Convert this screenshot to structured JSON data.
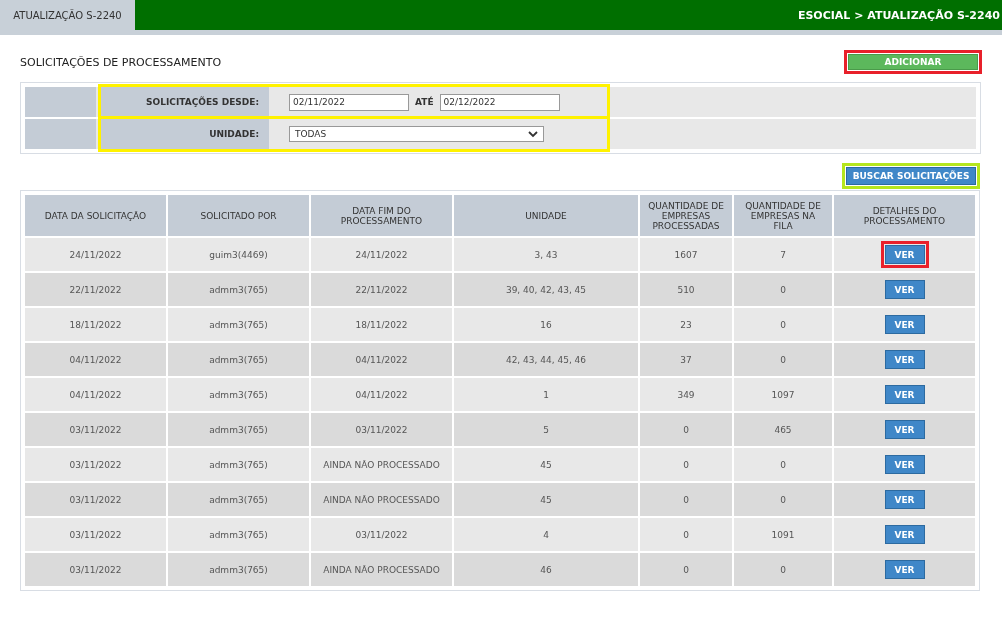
{
  "header": {
    "tab": {
      "label": "ATUALIZAÇÃO S-2240",
      "selected": true
    },
    "breadcrumb": "ESOCIAL > ATUALIZAÇÃO S-2240"
  },
  "page_title": "SOLICITAÇÕES DE PROCESSAMENTO",
  "add_button": {
    "label": "ADICIONAR",
    "highlighted": true
  },
  "filters": [
    {
      "label": "SOLICITAÇÕES DESDE:",
      "kind": "daterange",
      "from": "02/11/2022",
      "between": "ATÉ",
      "to": "02/12/2022",
      "highlighted": true
    },
    {
      "label": "UNIDADE:",
      "kind": "select",
      "value": "TODAS",
      "highlighted": true
    }
  ],
  "search_button": {
    "label": "BUSCAR SOLICITAÇÕES",
    "highlighted": true
  },
  "table": {
    "columns": [
      "DATA DA SOLICITAÇÃO",
      "SOLICITADO POR",
      "DATA FIM DO PROCESSAMENTO",
      "UNIDADE",
      "QUANTIDADE DE EMPRESAS PROCESSADAS",
      "QUANTIDADE DE EMPRESAS NA FILA",
      "DETALHES DO PROCESSAMENTO"
    ],
    "rows": [
      {
        "cells": [
          "24/11/2022",
          "guim3(4469)",
          "24/11/2022",
          "3, 43",
          "1607",
          "7"
        ],
        "action": "VER",
        "highlighted": true
      },
      {
        "cells": [
          "22/11/2022",
          "admm3(765)",
          "22/11/2022",
          "39, 40, 42, 43, 45",
          "510",
          "0"
        ],
        "action": "VER",
        "highlighted": false
      },
      {
        "cells": [
          "18/11/2022",
          "admm3(765)",
          "18/11/2022",
          "16",
          "23",
          "0"
        ],
        "action": "VER",
        "highlighted": false
      },
      {
        "cells": [
          "04/11/2022",
          "admm3(765)",
          "04/11/2022",
          "42, 43, 44, 45, 46",
          "37",
          "0"
        ],
        "action": "VER",
        "highlighted": false
      },
      {
        "cells": [
          "04/11/2022",
          "admm3(765)",
          "04/11/2022",
          "1",
          "349",
          "1097"
        ],
        "action": "VER",
        "highlighted": false
      },
      {
        "cells": [
          "03/11/2022",
          "admm3(765)",
          "03/11/2022",
          "5",
          "0",
          "465"
        ],
        "action": "VER",
        "highlighted": false
      },
      {
        "cells": [
          "03/11/2022",
          "admm3(765)",
          "AINDA NÃO PROCESSADO",
          "45",
          "0",
          "0"
        ],
        "action": "VER",
        "highlighted": false
      },
      {
        "cells": [
          "03/11/2022",
          "admm3(765)",
          "AINDA NÃO PROCESSADO",
          "45",
          "0",
          "0"
        ],
        "action": "VER",
        "highlighted": false
      },
      {
        "cells": [
          "03/11/2022",
          "admm3(765)",
          "03/11/2022",
          "4",
          "0",
          "1091"
        ],
        "action": "VER",
        "highlighted": false
      },
      {
        "cells": [
          "03/11/2022",
          "admm3(765)",
          "AINDA NÃO PROCESSADO",
          "46",
          "0",
          "0"
        ],
        "action": "VER",
        "highlighted": false
      }
    ]
  }
}
